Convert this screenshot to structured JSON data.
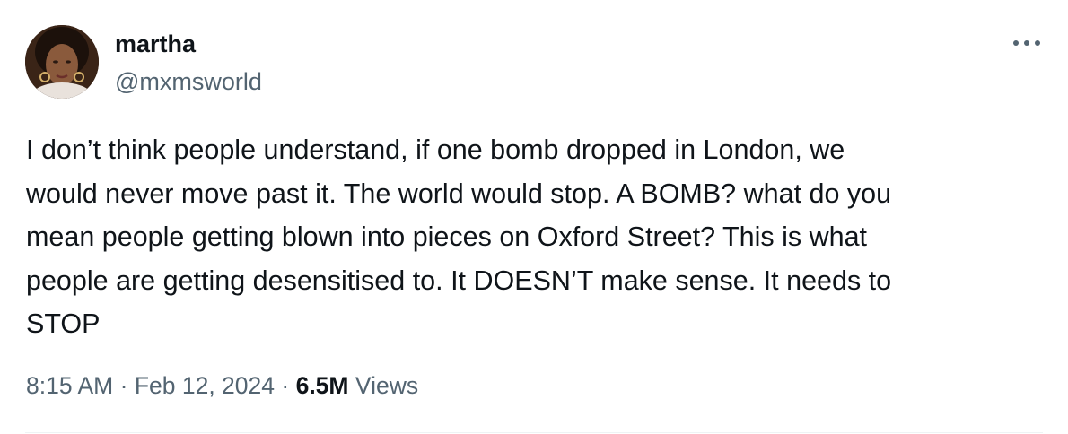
{
  "author": {
    "display_name": "martha",
    "handle": "@mxmsworld"
  },
  "more_icon": "more-horizontal-icon",
  "tweet": {
    "text": "I don’t think people understand, if one bomb dropped in London, we\nwould never move past it. The world would stop. A BOMB? what do you\nmean people getting blown into pieces on Oxford Street? This is what\npeople are getting desensitised to. It DOESN’T make sense. It needs to\nSTOP",
    "time": "8:15 AM",
    "separator": "·",
    "date": "Feb 12, 2024",
    "views_count": "6.5M",
    "views_label": "Views"
  },
  "colors": {
    "primary_text": "#0f1419",
    "secondary_text": "#536471",
    "divider": "#eff3f4"
  }
}
